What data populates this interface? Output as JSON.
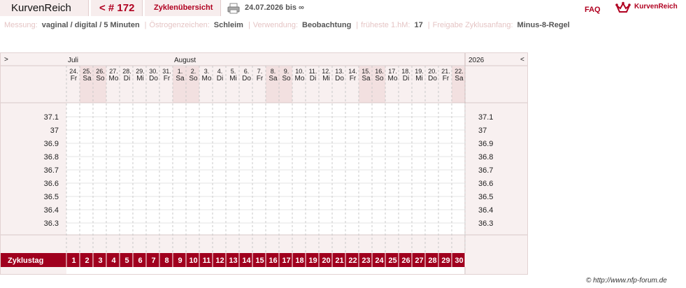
{
  "header": {
    "app_title": "KurvenReich",
    "cycle_nav": "< # 172",
    "overview_tab": "Zyklenübersicht",
    "print_icon": "printer-icon",
    "date_range": "24.07.2026 bis ∞",
    "faq": "FAQ",
    "logo_icon": "crown-icon",
    "logo_text": "KurvenReich"
  },
  "settings": {
    "items": [
      {
        "label": "Messung:",
        "value": "vaginal / digital / 5 Minuten"
      },
      {
        "label": "Östrogenzeichen:",
        "value": "Schleim"
      },
      {
        "label": "Verwendung:",
        "value": "Beobachtung"
      },
      {
        "label": "früheste 1.hM:",
        "value": "17"
      },
      {
        "label": "Freigabe Zyklusanfang:",
        "value": "Minus-8-Regel"
      }
    ],
    "separator": "|"
  },
  "chart": {
    "nav_prev": ">",
    "nav_next": "<",
    "year": "2026",
    "months": [
      {
        "name": "Juli",
        "start_index": 0
      },
      {
        "name": "August",
        "start_index": 8
      }
    ],
    "days": [
      {
        "num": "24.",
        "wd": "Fr",
        "weekend": false
      },
      {
        "num": "25.",
        "wd": "Sa",
        "weekend": true
      },
      {
        "num": "26.",
        "wd": "So",
        "weekend": true
      },
      {
        "num": "27.",
        "wd": "Mo",
        "weekend": false
      },
      {
        "num": "28.",
        "wd": "Di",
        "weekend": false
      },
      {
        "num": "29.",
        "wd": "Mi",
        "weekend": false
      },
      {
        "num": "30.",
        "wd": "Do",
        "weekend": false
      },
      {
        "num": "31.",
        "wd": "Fr",
        "weekend": false
      },
      {
        "num": "1.",
        "wd": "Sa",
        "weekend": true
      },
      {
        "num": "2.",
        "wd": "So",
        "weekend": true
      },
      {
        "num": "3.",
        "wd": "Mo",
        "weekend": false
      },
      {
        "num": "4.",
        "wd": "Di",
        "weekend": false
      },
      {
        "num": "5.",
        "wd": "Mi",
        "weekend": false
      },
      {
        "num": "6.",
        "wd": "Do",
        "weekend": false
      },
      {
        "num": "7.",
        "wd": "Fr",
        "weekend": false
      },
      {
        "num": "8.",
        "wd": "Sa",
        "weekend": true
      },
      {
        "num": "9.",
        "wd": "So",
        "weekend": true
      },
      {
        "num": "10.",
        "wd": "Mo",
        "weekend": false
      },
      {
        "num": "11.",
        "wd": "Di",
        "weekend": false
      },
      {
        "num": "12.",
        "wd": "Mi",
        "weekend": false
      },
      {
        "num": "13.",
        "wd": "Do",
        "weekend": false
      },
      {
        "num": "14.",
        "wd": "Fr",
        "weekend": false
      },
      {
        "num": "15.",
        "wd": "Sa",
        "weekend": true
      },
      {
        "num": "16.",
        "wd": "So",
        "weekend": true
      },
      {
        "num": "17.",
        "wd": "Mo",
        "weekend": false
      },
      {
        "num": "18.",
        "wd": "Di",
        "weekend": false
      },
      {
        "num": "19.",
        "wd": "Mi",
        "weekend": false
      },
      {
        "num": "20.",
        "wd": "Do",
        "weekend": false
      },
      {
        "num": "21.",
        "wd": "Fr",
        "weekend": false
      },
      {
        "num": "22.",
        "wd": "Sa",
        "weekend": true
      }
    ],
    "temperatures": [
      "37.1",
      "37",
      "36.9",
      "36.8",
      "36.7",
      "36.6",
      "36.5",
      "36.4",
      "36.3"
    ],
    "cycle_day_label": "Zyklustag",
    "cycle_days": [
      "1",
      "2",
      "3",
      "4",
      "5",
      "6",
      "7",
      "8",
      "9",
      "10",
      "11",
      "12",
      "13",
      "14",
      "15",
      "16",
      "17",
      "18",
      "19",
      "20",
      "21",
      "22",
      "23",
      "24",
      "25",
      "26",
      "27",
      "28",
      "29",
      "30"
    ],
    "colors": {
      "accent": "#a0001e",
      "panel": "#f8f0f0",
      "weekend": "#f2e0e0"
    }
  },
  "footer": {
    "copyright": "© http://www.nfp-forum.de"
  }
}
